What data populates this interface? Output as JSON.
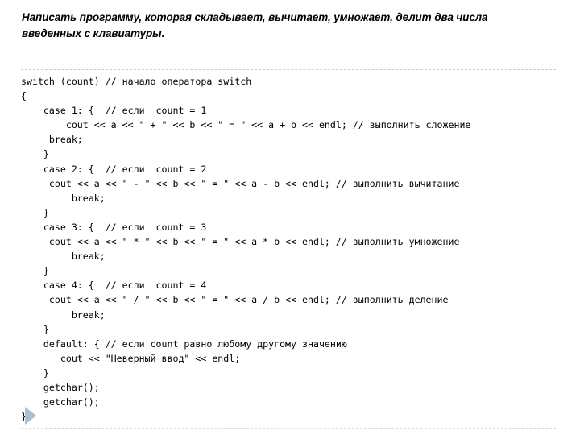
{
  "slide": {
    "background_color": "#ffffff",
    "title": {
      "lines": [
        "Написать программу, которая складывает, вычитает, умножает, делит два числа",
        "введенных с клавиатуры."
      ]
    },
    "code": {
      "language": "cpp",
      "text_color": "#000000",
      "lines": [
        "switch (count) // начало оператора switch",
        "{",
        "    case 1: {  // если  count = 1",
        "        cout << a << \" + \" << b << \" = \" << a + b << endl; // выполнить сложение",
        "     break;",
        "    }",
        "    case 2: {  // если  count = 2",
        "     cout << a << \" - \" << b << \" = \" << a - b << endl; // выполнить вычитание",
        "         break;",
        "    }",
        "    case 3: {  // если  count = 3",
        "     cout << a << \" * \" << b << \" = \" << a * b << endl; // выполнить умножение",
        "         break;",
        "    }",
        "    case 4: {  // если  count = 4",
        "     cout << a << \" / \" << b << \" = \" << a / b << endl; // выполнить деление",
        "         break;",
        "    }",
        "    default: { // если count равно любому другому значению",
        "       cout << \"Неверный ввод\" << endl;",
        "    }",
        "    getchar();",
        "    getchar();",
        "}"
      ]
    },
    "play_arrow": {
      "color": "#aebdd4",
      "label": "next-slide-arrow"
    },
    "dividers": {
      "top_color": "#cfcfcf",
      "bottom_color": "#dcdcdc",
      "style": "dashed"
    }
  }
}
